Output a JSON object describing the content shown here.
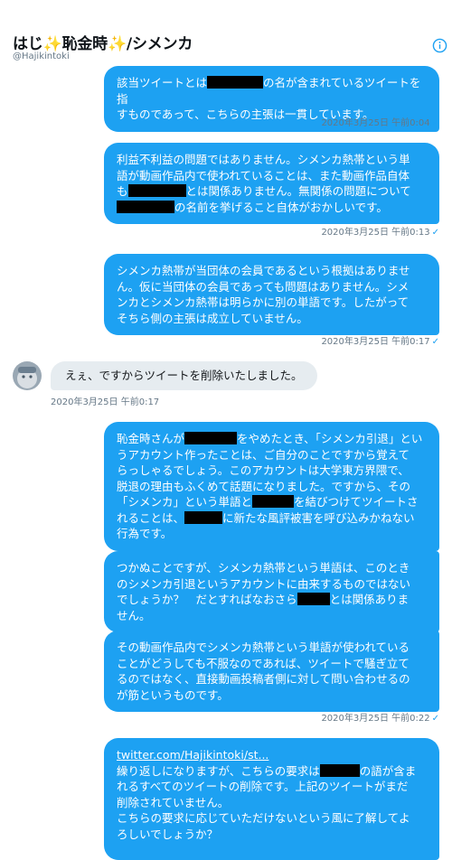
{
  "header": {
    "title": "はじ✨恥金時✨/シメンカ",
    "handle": "@Hajikintoki"
  },
  "messages": [
    {
      "lines": [
        [
          "該当ツイートとは",
          "[R]",
          "の名が含まれているツイートを指"
        ],
        [
          "すものであって、こちらの主張は一貫しています。"
        ]
      ],
      "timestamp": "2020年3月25日 午前0:04"
    },
    {
      "lines": [
        [
          "利益不利益の問題ではありません。シメンカ熱帯という単"
        ],
        [
          "語が動画作品内で使われていることは、また動画作品自体"
        ],
        [
          "も",
          "[R]",
          "とは関係ありません。無関係の問題について"
        ],
        [
          "[R]",
          "の名前を挙げること自体がおかしいです。"
        ]
      ],
      "timestamp": "2020年3月25日 午前0:13"
    },
    {
      "lines": [
        [
          "シメンカ熱帯が当団体の会員であるという根拠はありませ"
        ],
        [
          "ん。仮に当団体の会員であっても問題はありません。シメ"
        ],
        [
          "ンカとシメンカ熱帯は明らかに別の単語です。したがって"
        ],
        [
          "そちら側の主張は成立していません。"
        ]
      ],
      "timestamp": "2020年3月25日 午前0:17"
    },
    {
      "lines": [
        [
          "恥金時さんが",
          "[R]",
          "をやめたとき、「シメンカ引退」とい"
        ],
        [
          "うアカウント作ったことは、ご自分のことですから覚えて"
        ],
        [
          "らっしゃるでしょう。このアカウントは大学東方界隈で、"
        ],
        [
          "脱退の理由もふくめて話題になりました。ですから、その"
        ],
        [
          "「シメンカ」という単語と",
          "[R]",
          "を結びつけてツイートさ"
        ],
        [
          "れることは、",
          "[R]",
          "に新たな風評被害を呼び込みかねない"
        ],
        [
          "行為です。"
        ]
      ]
    },
    {
      "lines": [
        [
          "つかぬことですが、シメンカ熱帯という単語は、このとき"
        ],
        [
          "のシメンカ引退というアカウントに由来するものではない"
        ],
        [
          "でしょうか？　だとすればなおさら",
          "[R]",
          "とは関係ありま"
        ],
        [
          "せん。"
        ]
      ]
    },
    {
      "lines": [
        [
          "その動画作品内でシメンカ熱帯という単語が使われている"
        ],
        [
          "ことがどうしても不服なのであれば、ツイートで騒ぎ立て"
        ],
        [
          "るのではなく、直接動画投稿者側に対して問い合わせるの"
        ],
        [
          "が筋というものです。"
        ]
      ],
      "timestamp": "2020年3月25日 午前0:22"
    },
    {
      "link": "twitter.com/Hajikintoki/st...",
      "lines": [
        [
          "繰り返しになりますが、こちらの要求は",
          "[R]",
          "の語が含ま"
        ],
        [
          "れるすべてのツイートの削除です。上記のツイートがまだ"
        ],
        [
          "削除されていません。"
        ],
        [
          "こちらの要求に応じていただけないという風に了解してよ"
        ],
        [
          "ろしいでしょうか？"
        ]
      ]
    }
  ],
  "incoming": {
    "text": "えぇ、ですからツイートを削除いたしました。",
    "timestamp": "2020年3月25日 午前0:17"
  },
  "colors": {
    "bubble_out": "#1da1f2",
    "bubble_in": "#e6ecf0",
    "muted": "#657786"
  },
  "icons": [
    "info-icon",
    "avatar",
    "read-check-icon"
  ]
}
